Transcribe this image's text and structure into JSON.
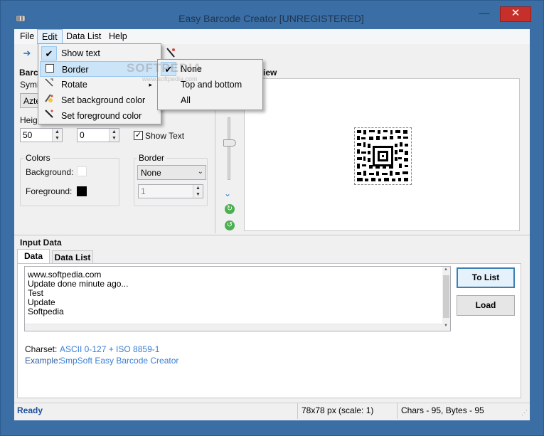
{
  "window": {
    "title": "Easy Barcode Creator [UNREGISTERED]",
    "minimize_glyph": "—",
    "maximize_glyph": "☐",
    "close_glyph": "✕"
  },
  "menubar": {
    "file": "File",
    "edit": "Edit",
    "data_list": "Data List",
    "help": "Help"
  },
  "edit_menu": {
    "items": [
      {
        "label": "Show text",
        "checked": true
      },
      {
        "label": "Border",
        "highlighted": true
      },
      {
        "label": "Rotate",
        "submenu_arrow": "▸"
      },
      {
        "label": "Set background color"
      },
      {
        "label": "Set foreground color"
      }
    ]
  },
  "border_submenu": {
    "items": [
      {
        "label": "None",
        "checked": true
      },
      {
        "label": "Top and bottom"
      },
      {
        "label": "All"
      }
    ]
  },
  "left_panel": {
    "section_title_fragment": "Barc",
    "symbology_label_fragment": "Symb",
    "symbology_value_fragment": "Azte",
    "height_label_fragment": "Heig",
    "height_value": "50",
    "second_value": "0",
    "show_text_label": "Show Text",
    "show_text_checked": true,
    "colors_group": "Colors",
    "background_label": "Background:",
    "foreground_label": "Foreground:",
    "background_color": "#ffffff",
    "foreground_color": "#000000",
    "border_group": "Border",
    "border_value": "None",
    "border_width_value": "1"
  },
  "preview": {
    "title_fragment": "iew"
  },
  "input_data": {
    "title": "Input Data",
    "tabs": [
      "Data",
      "Data List"
    ],
    "lines": [
      "www.softpedia.com",
      "Update done minute ago...",
      "Test",
      "Update",
      "Softpedia"
    ],
    "to_list_button": "To List",
    "load_button": "Load",
    "charset_label": "Charset:",
    "charset_value": "ASCII 0-127 + ISO 8859-1",
    "example_label": "Example:",
    "example_value": "SmpSoft Easy Barcode Creator"
  },
  "statusbar": {
    "status": "Ready",
    "size": "78x78 px (scale: 1)",
    "counts": "Chars - 95, Bytes - 95"
  },
  "watermark": {
    "text": "SOFTPEDIA",
    "url": "www.softpedia.com"
  }
}
